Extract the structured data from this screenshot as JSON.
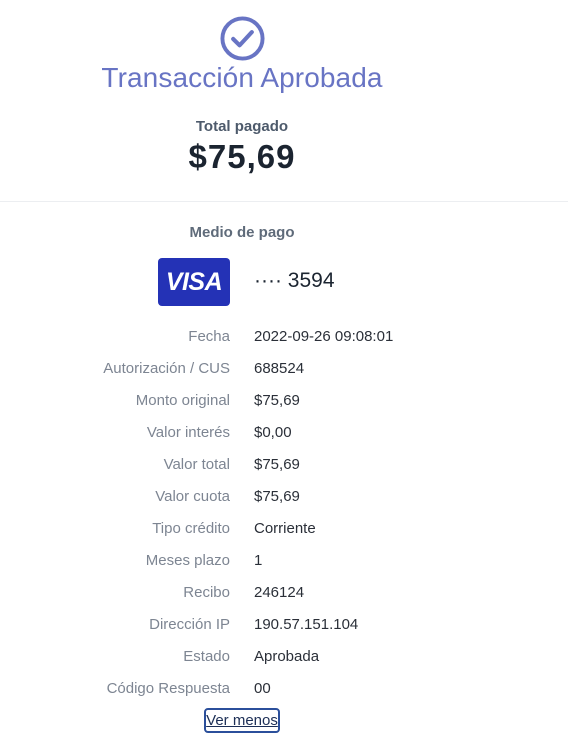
{
  "header": {
    "icon": "check-circle-icon",
    "title": "Transacción Aprobada",
    "total_label": "Total pagado",
    "total_amount": "$75,69",
    "accent_color": "#6874c4"
  },
  "payment_method": {
    "label": "Medio de pago",
    "card_brand": "VISA",
    "card_number": "···· 3594",
    "card_color": "#2432b6"
  },
  "details": [
    {
      "label": "Fecha",
      "value": "2022-09-26 09:08:01"
    },
    {
      "label": "Autorización / CUS",
      "value": "688524"
    },
    {
      "label": "Monto original",
      "value": "$75,69"
    },
    {
      "label": "Valor interés",
      "value": "$0,00"
    },
    {
      "label": "Valor total",
      "value": "$75,69"
    },
    {
      "label": "Valor cuota",
      "value": "$75,69"
    },
    {
      "label": "Tipo crédito",
      "value": "Corriente"
    },
    {
      "label": "Meses plazo",
      "value": "1"
    },
    {
      "label": "Recibo",
      "value": "246124"
    },
    {
      "label": "Dirección IP",
      "value": "190.57.151.104"
    },
    {
      "label": "Estado",
      "value": "Aprobada"
    },
    {
      "label": "Código Respuesta",
      "value": "00"
    }
  ],
  "toggle": {
    "label": "Ver menos"
  }
}
